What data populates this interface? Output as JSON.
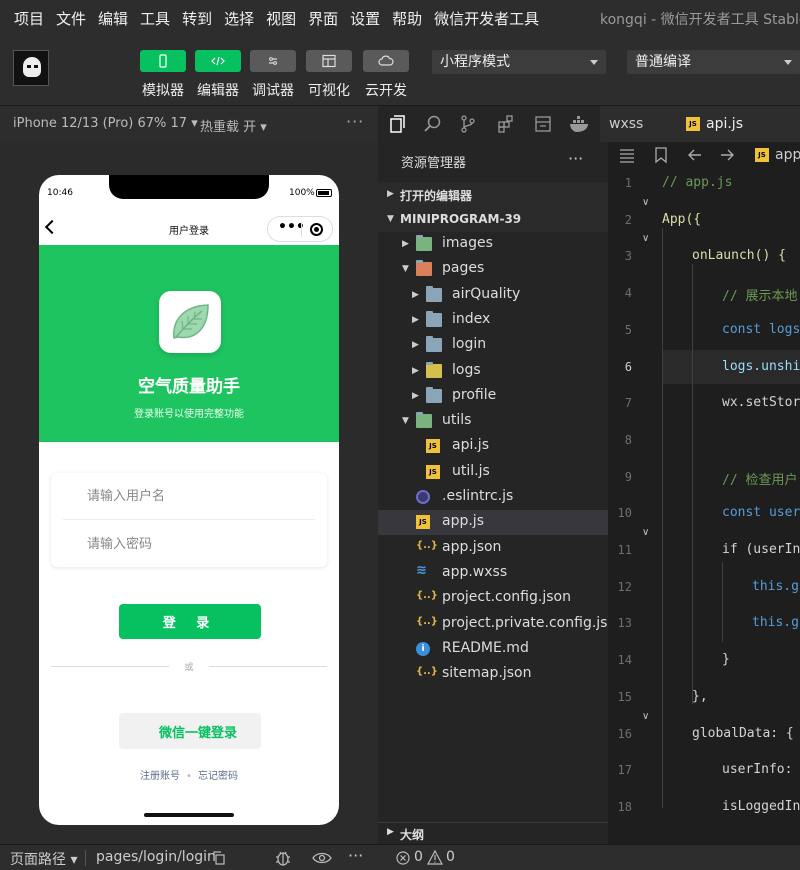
{
  "menubar": {
    "items": [
      "项目",
      "文件",
      "编辑",
      "工具",
      "转到",
      "选择",
      "视图",
      "界面",
      "设置",
      "帮助",
      "微信开发者工具"
    ],
    "app_title": "kongqi - 微信开发者工具 Stable"
  },
  "toolbar": {
    "buttons": [
      {
        "label": "模拟器",
        "icon": "phone-icon"
      },
      {
        "label": "编辑器",
        "icon": "code-icon"
      },
      {
        "label": "调试器",
        "icon": "debug-icon"
      },
      {
        "label": "可视化",
        "icon": "layout-icon"
      },
      {
        "label": "云开发",
        "icon": "cloud-icon"
      }
    ],
    "mode_select": "小程序模式",
    "compile_select": "普通编译"
  },
  "simulator": {
    "device": "iPhone 12/13 (Pro) 67% 17 ▾",
    "hot_reload": "热重载 开 ▾",
    "more": "···"
  },
  "phone": {
    "time": "10:46",
    "battery": "100%",
    "nav_title": "用户登录",
    "app_name": "空气质量助手",
    "subtitle": "登录账号以使用完整功能",
    "username_placeholder": "请输入用户名",
    "password_placeholder": "请输入密码",
    "login_button": "登 录",
    "or_text": "或",
    "wechat_login": "微信一键登录",
    "register_link": "注册账号",
    "link_separator": "•",
    "forgot_link": "忘记密码",
    "colors": {
      "brand": "#1ec45f",
      "button": "#07c160"
    }
  },
  "explorer": {
    "title": "资源管理器",
    "more": "···",
    "open_editors": "打开的编辑器",
    "project": "MINIPROGRAM-39",
    "outline": "大纲",
    "tree": [
      {
        "name": "images",
        "type": "folder-special",
        "depth": 1,
        "chevron": "▶"
      },
      {
        "name": "pages",
        "type": "folder-special",
        "depth": 1,
        "chevron": "▼"
      },
      {
        "name": "airQuality",
        "type": "folder",
        "depth": 2,
        "chevron": "▶"
      },
      {
        "name": "index",
        "type": "folder",
        "depth": 2,
        "chevron": "▶"
      },
      {
        "name": "login",
        "type": "folder",
        "depth": 2,
        "chevron": "▶"
      },
      {
        "name": "logs",
        "type": "folder-logs",
        "depth": 2,
        "chevron": "▶"
      },
      {
        "name": "profile",
        "type": "folder",
        "depth": 2,
        "chevron": "▶"
      },
      {
        "name": "utils",
        "type": "folder-special",
        "depth": 1,
        "chevron": "▼"
      },
      {
        "name": "api.js",
        "type": "js",
        "depth": 2,
        "chevron": ""
      },
      {
        "name": "util.js",
        "type": "js",
        "depth": 2,
        "chevron": ""
      },
      {
        "name": ".eslintrc.js",
        "type": "eslint",
        "depth": 1,
        "chevron": ""
      },
      {
        "name": "app.js",
        "type": "js",
        "depth": 1,
        "chevron": "",
        "selected": true
      },
      {
        "name": "app.json",
        "type": "json",
        "depth": 1,
        "chevron": ""
      },
      {
        "name": "app.wxss",
        "type": "css",
        "depth": 1,
        "chevron": ""
      },
      {
        "name": "project.config.json",
        "type": "json",
        "depth": 1,
        "chevron": ""
      },
      {
        "name": "project.private.config.js...",
        "type": "json",
        "depth": 1,
        "chevron": ""
      },
      {
        "name": "README.md",
        "type": "info",
        "depth": 1,
        "chevron": ""
      },
      {
        "name": "sitemap.json",
        "type": "json",
        "depth": 1,
        "chevron": ""
      }
    ]
  },
  "tabs": [
    {
      "label": "wxss",
      "active": false
    },
    {
      "label": "api.js",
      "active": true
    }
  ],
  "editor": {
    "breadcrumb_file": "app",
    "current_line": 6,
    "lines": [
      {
        "n": 1,
        "text": "// app.js",
        "cls": "c-com",
        "indent": 0
      },
      {
        "n": 2,
        "text": "App({",
        "cls": "c-fn",
        "indent": 0
      },
      {
        "n": 3,
        "text": "onLaunch() {",
        "cls": "c-fn",
        "indent": 1
      },
      {
        "n": 4,
        "text": "// 展示本地",
        "cls": "c-com",
        "indent": 2
      },
      {
        "n": 5,
        "text": "const logs",
        "cls": "c-kw",
        "indent": 2
      },
      {
        "n": 6,
        "text": "logs.unshi",
        "cls": "c-var",
        "indent": 2
      },
      {
        "n": 7,
        "text": "wx.setStor",
        "cls": "c-def",
        "indent": 2
      },
      {
        "n": 8,
        "text": "",
        "cls": "c-def",
        "indent": 2
      },
      {
        "n": 9,
        "text": "// 检查用户",
        "cls": "c-com",
        "indent": 2
      },
      {
        "n": 10,
        "text": "const user",
        "cls": "c-kw",
        "indent": 2
      },
      {
        "n": 11,
        "text": "if (userIn",
        "cls": "c-def",
        "indent": 2
      },
      {
        "n": 12,
        "text": "this.g",
        "cls": "c-kw",
        "indent": 3
      },
      {
        "n": 13,
        "text": "this.g",
        "cls": "c-kw",
        "indent": 3
      },
      {
        "n": 14,
        "text": "}",
        "cls": "c-def",
        "indent": 2
      },
      {
        "n": 15,
        "text": "},",
        "cls": "c-def",
        "indent": 1
      },
      {
        "n": 16,
        "text": "globalData: {",
        "cls": "c-def",
        "indent": 1
      },
      {
        "n": 17,
        "text": "userInfo:",
        "cls": "c-def",
        "indent": 2
      },
      {
        "n": 18,
        "text": "isLoggedIn",
        "cls": "c-def",
        "indent": 2
      }
    ]
  },
  "statusbar": {
    "page_path_label": "页面路径 ▾",
    "page_path": "pages/login/login",
    "errors": "0",
    "warnings": "0"
  }
}
